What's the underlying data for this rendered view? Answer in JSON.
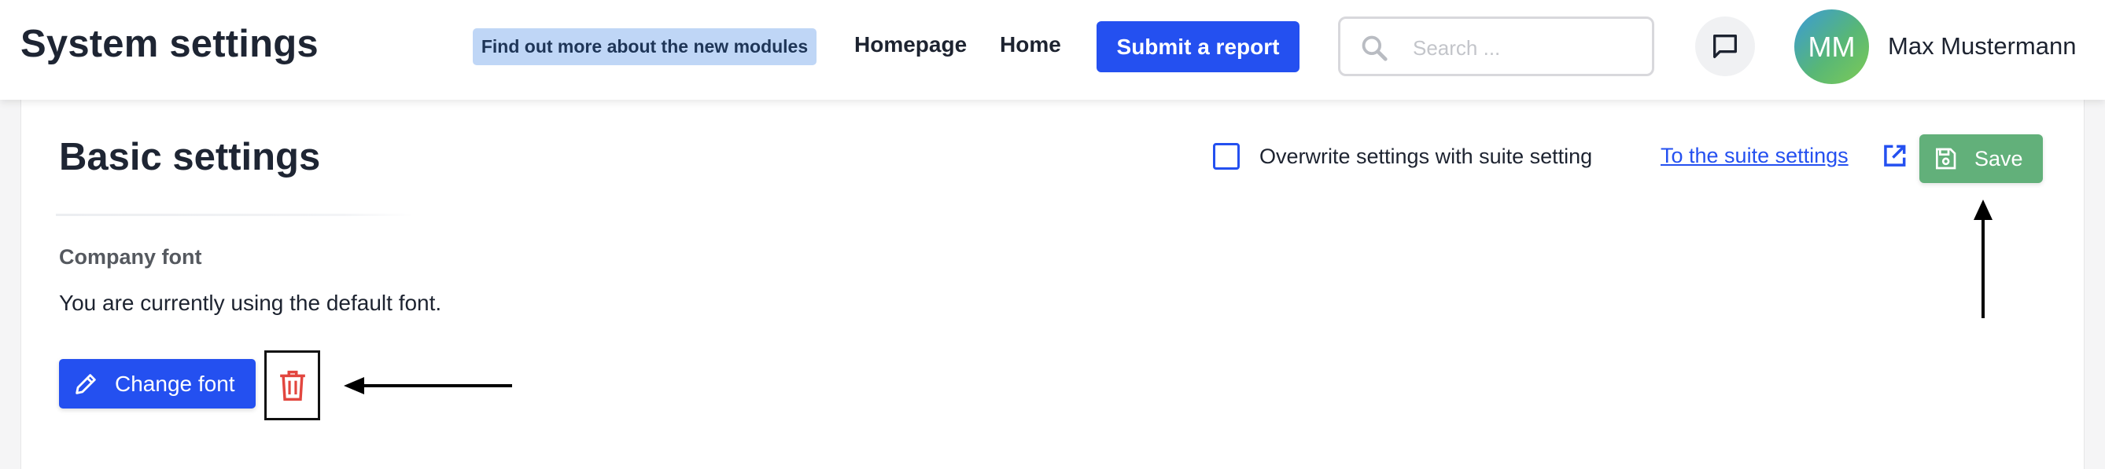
{
  "header": {
    "title": "System settings",
    "promo_label": "Find out more about the new modules",
    "nav": {
      "homepage": "Homepage",
      "home": "Home"
    },
    "report_button": "Submit a report",
    "search": {
      "placeholder": "Search ...",
      "value": "",
      "icon": "search-icon"
    },
    "chat_icon": "chat-icon",
    "user": {
      "initials": "MM",
      "name": "Max Mustermann"
    }
  },
  "settings": {
    "title": "Basic settings",
    "overwrite": {
      "label": "Overwrite settings with suite setting",
      "checked": false
    },
    "suite_link": "To the suite settings",
    "save_label": "Save",
    "company_font": {
      "label": "Company font",
      "status": "You are currently using the default font.",
      "change_button": "Change font"
    }
  },
  "colors": {
    "primary": "#2450f0",
    "save_green": "#62b07a",
    "delete_red": "#e2463f",
    "promo_bg": "#bfd6f6"
  }
}
